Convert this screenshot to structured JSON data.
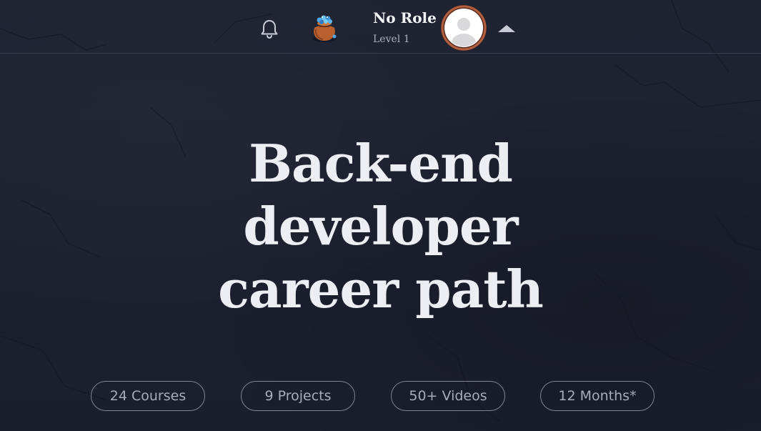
{
  "header": {
    "user_name": "No Role",
    "user_level": "Level 1",
    "icons": {
      "notifications": "bell-icon",
      "inventory": "gem-pouch-icon",
      "avatar": "user-avatar-placeholder",
      "menu_toggle": "caret-up-icon"
    }
  },
  "hero": {
    "title_lines": [
      "Back-end",
      "developer",
      "career path"
    ]
  },
  "stats": [
    {
      "label": "24 Courses"
    },
    {
      "label": "9 Projects"
    },
    {
      "label": "50+ Videos"
    },
    {
      "label": "12 Months*"
    }
  ],
  "colors": {
    "background": "#1d2130",
    "title_text": "#eceef4",
    "pill_border": "#7e8395",
    "pill_text": "#a7abbb",
    "avatar_ring": "#b0603f"
  }
}
